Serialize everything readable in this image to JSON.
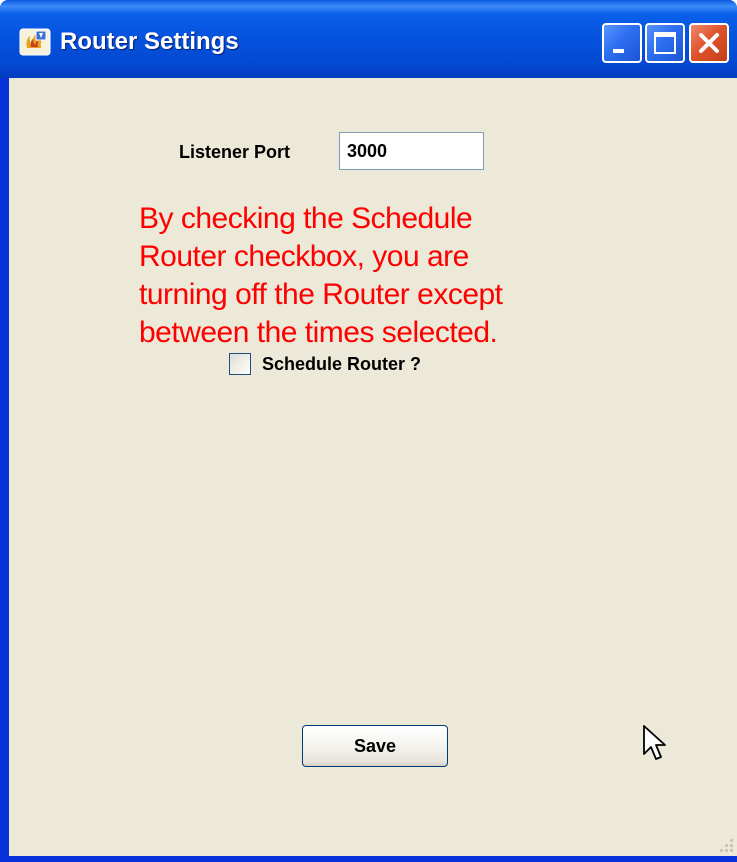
{
  "window": {
    "title": "Router Settings",
    "app_icon": "java-cup-icon",
    "controls": {
      "minimize_icon": "minimize-icon",
      "maximize_icon": "maximize-icon",
      "close_icon": "close-icon"
    }
  },
  "form": {
    "listener_port_label": "Listener Port",
    "listener_port_value": "3000",
    "warning_lines": [
      "By checking the Schedule",
      "Router checkbox, you are",
      "turning off the Router except",
      "between the times selected."
    ],
    "schedule_label": "Schedule Router ?",
    "schedule_checked": false,
    "save_label": "Save"
  },
  "colors": {
    "titlebar_blue": "#0552dd",
    "panel_background": "#ece9d8",
    "warning_text": "#ff0000",
    "close_button": "#e0542c"
  }
}
